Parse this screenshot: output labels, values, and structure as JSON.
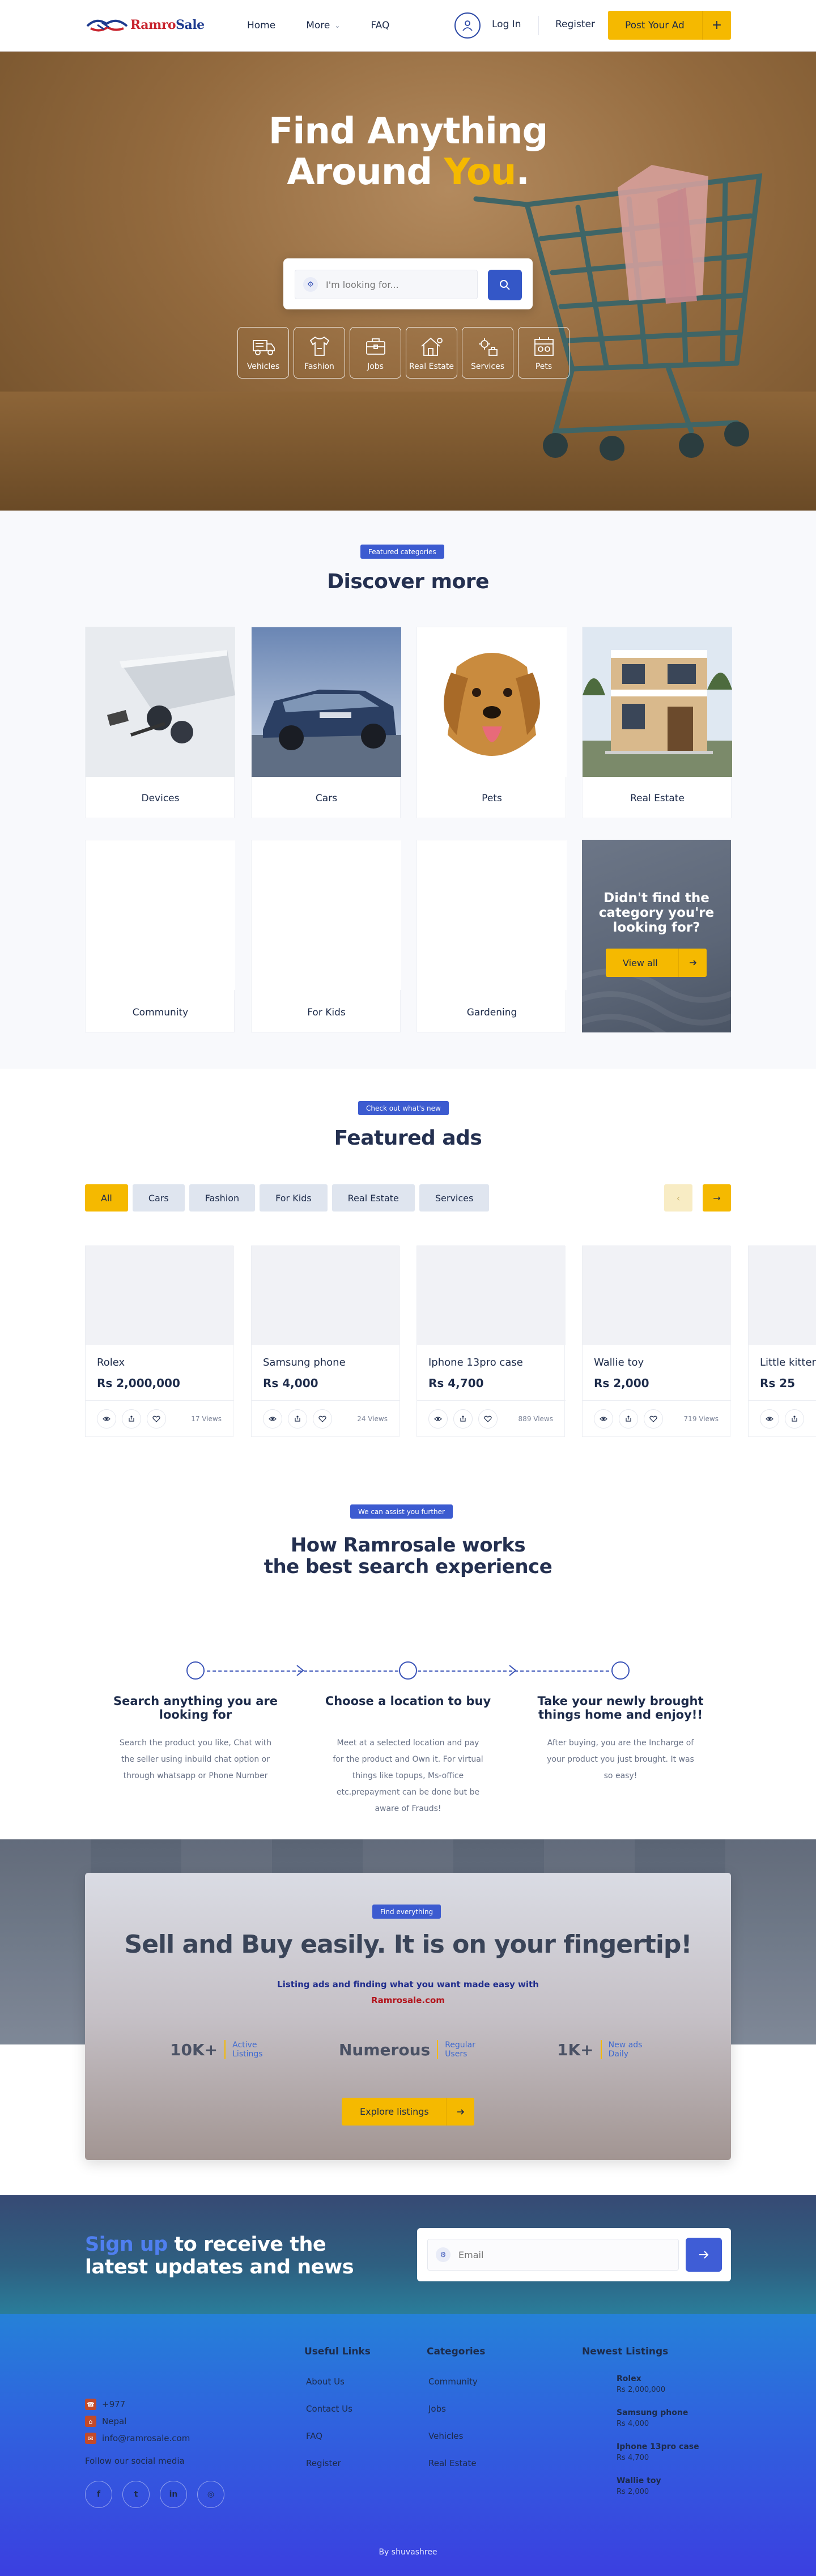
{
  "header": {
    "logo_text_1": "Ramro",
    "logo_text_2": "Sale",
    "nav": [
      {
        "label": "Home"
      },
      {
        "label": "More"
      },
      {
        "label": "FAQ"
      }
    ],
    "login_label": "Log In",
    "register_label": "Register",
    "post_ad_label": "Post Your Ad",
    "post_ad_icon": "+"
  },
  "hero": {
    "title_line1": "Find Anything",
    "title_line2_a": "Around ",
    "title_line2_b": "You",
    "title_line2_c": ".",
    "search_placeholder": "I'm looking for...",
    "categories": [
      {
        "label": "Vehicles",
        "icon": "truck-icon"
      },
      {
        "label": "Fashion",
        "icon": "tshirt-icon"
      },
      {
        "label": "Jobs",
        "icon": "briefcase-icon"
      },
      {
        "label": "Real Estate",
        "icon": "house-icon"
      },
      {
        "label": "Services",
        "icon": "services-icon"
      },
      {
        "label": "Pets",
        "icon": "pets-icon"
      }
    ]
  },
  "categories_section": {
    "badge": "Featured categories",
    "title": "Discover more",
    "cards": [
      {
        "label": "Devices"
      },
      {
        "label": "Cars"
      },
      {
        "label": "Pets"
      },
      {
        "label": "Real Estate"
      },
      {
        "label": "Community"
      },
      {
        "label": "For Kids"
      },
      {
        "label": "Gardening"
      }
    ],
    "cta_title": "Didn't find the category you're looking for?",
    "cta_button": "View all"
  },
  "featured": {
    "badge": "Check out what's new",
    "title": "Featured ads",
    "filters": [
      "All",
      "Cars",
      "Fashion",
      "For Kids",
      "Real Estate",
      "Services"
    ],
    "active_filter": "All",
    "ads": [
      {
        "name": "Rolex",
        "price": "Rs 2,000,000",
        "views": "17 Views"
      },
      {
        "name": "Samsung phone",
        "price": "Rs 4,000",
        "views": "24 Views"
      },
      {
        "name": "Iphone 13pro case",
        "price": "Rs 4,700",
        "views": "889 Views"
      },
      {
        "name": "Wallie toy",
        "price": "Rs 2,000",
        "views": "719 Views"
      },
      {
        "name": "Little kitten",
        "price": "Rs 25",
        "views": ""
      }
    ]
  },
  "how": {
    "badge": "We can assist you further",
    "title_line1": "How Ramrosale works",
    "title_line2": "the best search experience",
    "steps": [
      {
        "title": "Search anything you are looking for",
        "desc": "Search the product you like, Chat with the seller using inbuild chat option or through whatsapp or Phone Number"
      },
      {
        "title": "Choose a location to buy",
        "desc": "Meet at a selected location and pay for the product and Own it. For virtual things like topups, Ms-office etc.prepayment can be done but be aware of Frauds!"
      },
      {
        "title": "Take your newly brought things home and enjoy!!",
        "desc": "After buying, you are the Incharge of your product you just brought. It was so easy!"
      }
    ]
  },
  "sell": {
    "badge": "Find everything",
    "title": "Sell and Buy easily. It is on your fingertip!",
    "sub_line1": "Listing ads and finding what you want made easy with",
    "sub_line2": "Ramrosale.com",
    "stats": [
      {
        "value": "10K+",
        "label1": "Active",
        "label2": "Listings"
      },
      {
        "value": "Numerous",
        "label1": "Regular",
        "label2": "Users"
      },
      {
        "value": "1K+",
        "label1": "New ads",
        "label2": "Daily"
      }
    ],
    "button": "Explore listings"
  },
  "newsletter": {
    "title_a": "Sign up",
    "title_b": " to receive the latest updates and news",
    "email_placeholder": "Email"
  },
  "footer": {
    "phone": "+977",
    "country": "Nepal",
    "email": "info@ramrosale.com",
    "follow": "Follow our social media",
    "socials": [
      {
        "name": "facebook-icon",
        "glyph": "f"
      },
      {
        "name": "twitter-icon",
        "glyph": "t"
      },
      {
        "name": "linkedin-icon",
        "glyph": "in"
      },
      {
        "name": "instagram-icon",
        "glyph": "◎"
      }
    ],
    "useful_links_title": "Useful Links",
    "useful_links": [
      "About Us",
      "Contact Us",
      "FAQ",
      "Register"
    ],
    "categories_title": "Categories",
    "categories": [
      "Community",
      "Jobs",
      "Vehicles",
      "Real Estate"
    ],
    "newest_title": "Newest Listings",
    "newest": [
      {
        "name": "Rolex",
        "price": "Rs 2,000,000"
      },
      {
        "name": "Samsung phone",
        "price": "Rs 4,000"
      },
      {
        "name": "Iphone 13pro case",
        "price": "Rs 4,700"
      },
      {
        "name": "Wallie toy",
        "price": "Rs 2,000"
      }
    ],
    "credit": "By shuvashree"
  },
  "colors": {
    "accent_yellow": "#f5b900",
    "primary_blue": "#3457c7",
    "text_dark": "#1d2b4a"
  }
}
